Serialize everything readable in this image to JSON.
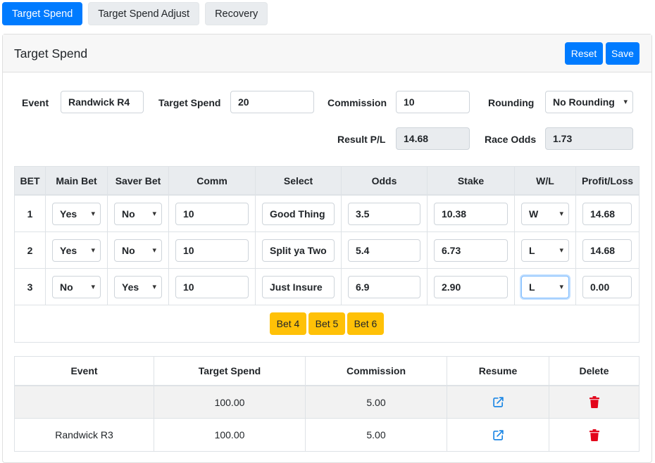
{
  "tabs": [
    {
      "label": "Target Spend",
      "active": true
    },
    {
      "label": "Target Spend Adjust",
      "active": false
    },
    {
      "label": "Recovery",
      "active": false
    }
  ],
  "card": {
    "title": "Target Spend",
    "reset_label": "Reset",
    "save_label": "Save"
  },
  "form": {
    "event_label": "Event",
    "event_value": "Randwick R4",
    "target_spend_label": "Target Spend",
    "target_spend_value": "20",
    "commission_label": "Commission",
    "commission_value": "10",
    "rounding_label": "Rounding",
    "rounding_value": "No Rounding",
    "result_pl_label": "Result P/L",
    "result_pl_value": "14.68",
    "race_odds_label": "Race Odds",
    "race_odds_value": "1.73"
  },
  "bets_table": {
    "headers": [
      "BET",
      "Main Bet",
      "Saver Bet",
      "Comm",
      "Select",
      "Odds",
      "Stake",
      "W/L",
      "Profit/Loss"
    ],
    "rows": [
      {
        "bet": "1",
        "main": "Yes",
        "saver": "No",
        "comm": "10",
        "select": "Good Thing",
        "odds": "3.5",
        "stake": "10.38",
        "wl": "W",
        "pl": "14.68"
      },
      {
        "bet": "2",
        "main": "Yes",
        "saver": "No",
        "comm": "10",
        "select": "Split ya Two",
        "odds": "5.4",
        "stake": "6.73",
        "wl": "L",
        "pl": "14.68"
      },
      {
        "bet": "3",
        "main": "No",
        "saver": "Yes",
        "comm": "10",
        "select": "Just Insure",
        "odds": "6.9",
        "stake": "2.90",
        "wl": "L",
        "pl": "0.00"
      }
    ],
    "add_buttons": [
      "Bet 4",
      "Bet 5",
      "Bet 6"
    ]
  },
  "saved_table": {
    "headers": [
      "Event",
      "Target Spend",
      "Commission",
      "Resume",
      "Delete"
    ],
    "rows": [
      {
        "event": "",
        "target_spend": "100.00",
        "commission": "5.00"
      },
      {
        "event": "Randwick R3",
        "target_spend": "100.00",
        "commission": "5.00"
      }
    ]
  },
  "colors": {
    "primary": "#007bff",
    "warning": "#ffc107",
    "danger": "#e3051b",
    "resume_icon": "#1e88e5"
  },
  "icons": {
    "resume": "external-link-icon",
    "delete": "trash-icon",
    "select": "chevron-down-icon"
  }
}
